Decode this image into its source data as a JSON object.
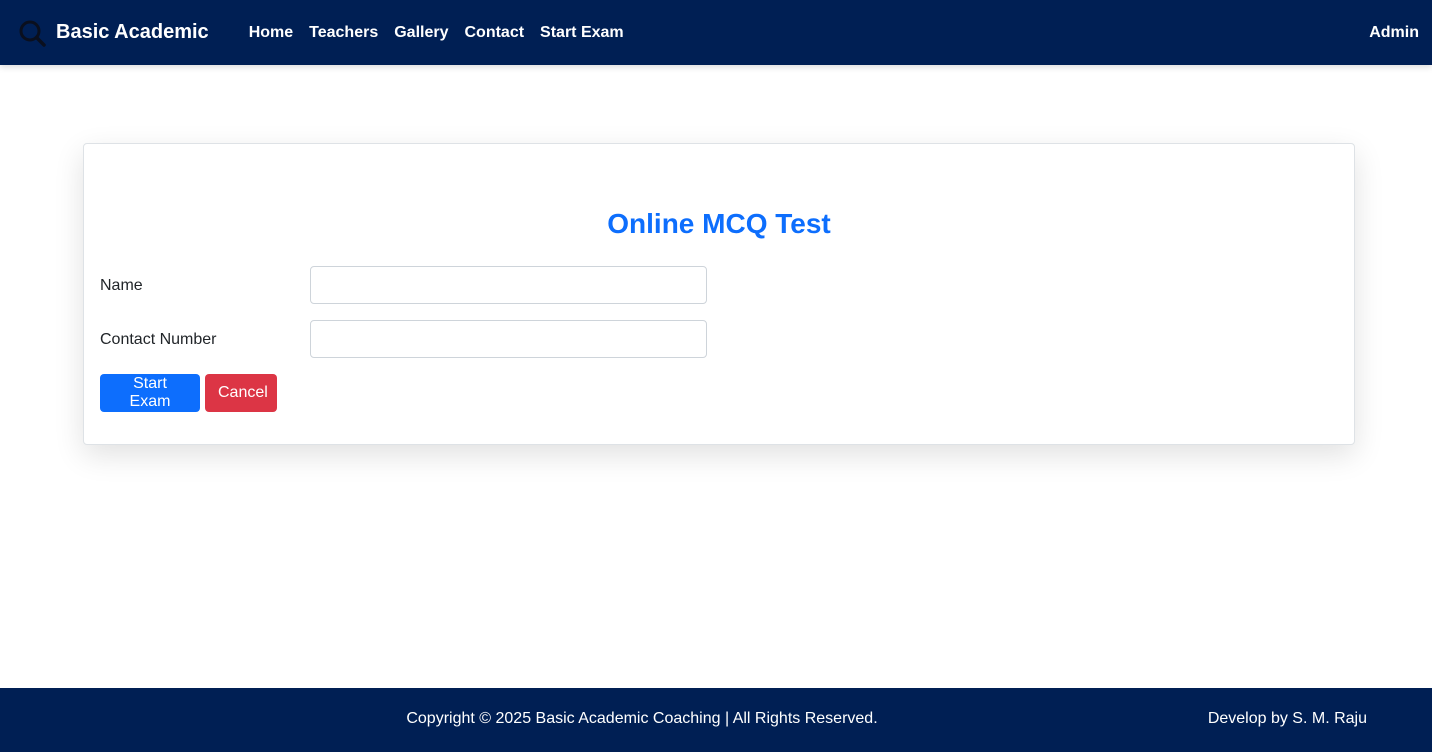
{
  "navbar": {
    "brand": "Basic Academic",
    "logo_icon": "magnifier-logo-icon",
    "links": [
      "Home",
      "Teachers",
      "Gallery",
      "Contact",
      "Start Exam"
    ],
    "right_link": "Admin"
  },
  "form": {
    "title": "Online MCQ Test",
    "name_label": "Name",
    "name_value": "",
    "contact_label": "Contact Number",
    "contact_value": "",
    "start_button": "Start Exam",
    "cancel_button": "Cancel"
  },
  "footer": {
    "copyright": "Copyright © 2025 Basic Academic Coaching | All Rights Reserved.",
    "developer": "Develop by S. M. Raju"
  },
  "colors": {
    "navbar_bg": "#001f54",
    "primary": "#0d6efd",
    "danger": "#dc3545"
  }
}
